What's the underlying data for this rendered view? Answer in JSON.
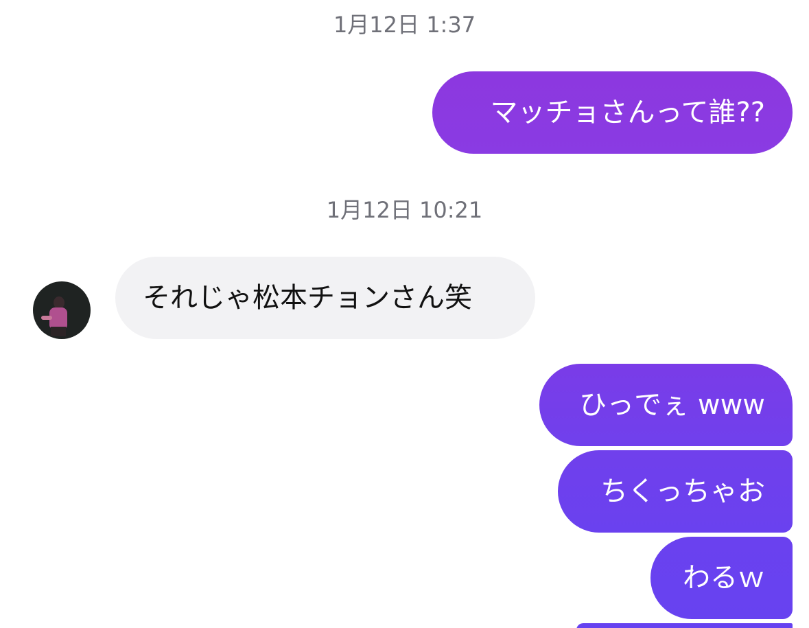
{
  "chat": {
    "timestamps": [
      "1月12日 1:37",
      "1月12日 10:21"
    ],
    "messages": [
      {
        "direction": "outgoing",
        "text": "マッチョさんって誰??"
      },
      {
        "direction": "incoming",
        "text": "それじゃ松本チョンさん笑"
      },
      {
        "direction": "outgoing",
        "text": "ひっでぇ www"
      },
      {
        "direction": "outgoing",
        "text": "ちくっちゃお"
      },
      {
        "direction": "outgoing",
        "text": "わるｗ"
      }
    ]
  },
  "colors": {
    "outgoing_gradient_top": "#8b39e0",
    "outgoing_gradient_bottom": "#6a40ee",
    "incoming_bubble": "#f2f2f4",
    "timestamp_text": "#6f7078"
  },
  "icons": {
    "avatar": "contact-avatar-photo"
  }
}
